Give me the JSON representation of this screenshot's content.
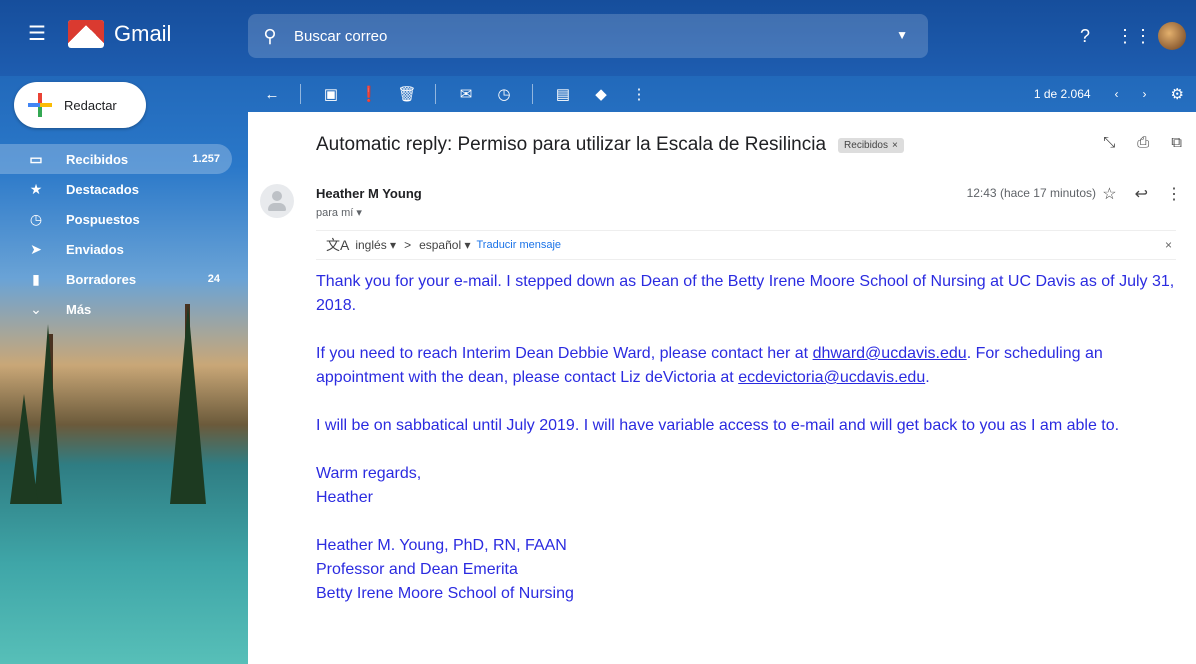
{
  "app": {
    "name": "Gmail"
  },
  "search": {
    "placeholder": "Buscar correo"
  },
  "compose": {
    "label": "Redactar"
  },
  "nav": [
    {
      "label": "Recibidos",
      "count": "1.257",
      "icon": "inbox-icon",
      "active": true
    },
    {
      "label": "Destacados",
      "count": "",
      "icon": "star-icon"
    },
    {
      "label": "Pospuestos",
      "count": "",
      "icon": "clock-icon"
    },
    {
      "label": "Enviados",
      "count": "",
      "icon": "send-icon"
    },
    {
      "label": "Borradores",
      "count": "24",
      "icon": "draft-icon"
    },
    {
      "label": "Más",
      "count": "",
      "icon": "chevron-down-icon"
    }
  ],
  "toolbar": {
    "pager": "1 de 2.064"
  },
  "email": {
    "subject": "Automatic reply: Permiso para utilizar la Escala de Resilincia",
    "label_chip": "Recibidos",
    "chip_close": "×",
    "sender": "Heather M Young",
    "to": "para mí",
    "time": "12:43 (hace 17 minutos)",
    "translate": {
      "from": "inglés",
      "arrow": ">",
      "to": "español",
      "action": "Traducir mensaje",
      "close": "×"
    },
    "body": {
      "p1": "Thank you for your e-mail. I stepped down as Dean of the Betty Irene Moore School of Nursing at UC Davis as of July 31, 2018.",
      "p2_a": "If you need to reach Interim Dean Debbie Ward, please contact her at ",
      "p2_link1": "dhward@ucdavis.edu",
      "p2_b": ".  For scheduling an appointment with the dean, please contact Liz deVictoria at ",
      "p2_link2": "ecdevictoria@ucdavis.edu",
      "p2_c": ".",
      "p3": "I will be on sabbatical until July 2019.  I will have variable access to e-mail and will get back to you as I am able to.",
      "closing1": "Warm regards,",
      "closing2": "Heather",
      "sig1": "Heather M. Young, PhD, RN, FAAN",
      "sig2": "Professor and Dean Emerita",
      "sig3": "Betty Irene Moore School of Nursing"
    }
  }
}
